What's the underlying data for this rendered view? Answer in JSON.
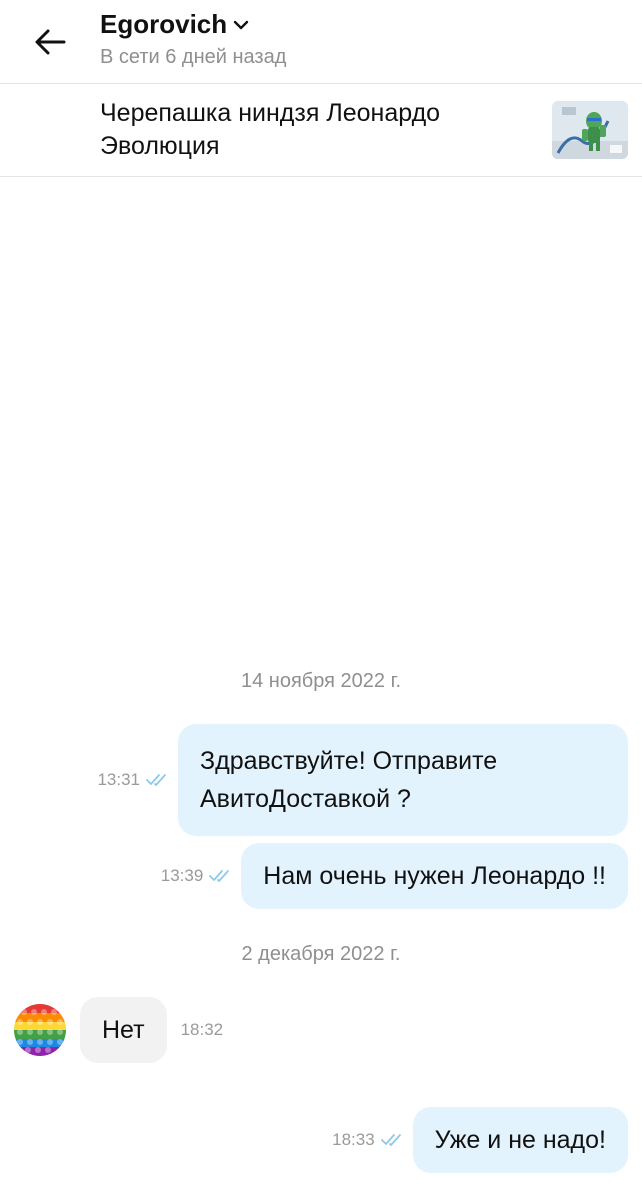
{
  "header": {
    "back_icon": "arrow-left-icon",
    "contact_name": "Egorovich",
    "chevron_icon": "chevron-down-icon",
    "status": "В сети 6 дней назад"
  },
  "item": {
    "title": "Черепашка ниндзя Леонардо Эволюция",
    "thumbnail_icon": "product-thumbnail"
  },
  "messages": {
    "date1": "14 ноября 2022 г.",
    "m1": {
      "text": "Здравствуйте! Отправите АвитоДоставкой ?",
      "time": "13:31",
      "status_icon": "double-check-icon"
    },
    "m2": {
      "text": "Нам очень нужен Леонардо !!",
      "time": "13:39",
      "status_icon": "double-check-icon"
    },
    "date2": "2 декабря 2022 г.",
    "m3": {
      "text": "Нет",
      "time": "18:32",
      "avatar_icon": "rainbow-popit-avatar"
    },
    "m4": {
      "text": "Уже и не надо!",
      "time": "18:33",
      "status_icon": "double-check-icon"
    }
  },
  "colors": {
    "outgoing_bubble": "#e3f3fd",
    "incoming_bubble": "#f2f2f2",
    "read_check": "#8ec9ea",
    "muted_text": "#8f8f8f"
  }
}
